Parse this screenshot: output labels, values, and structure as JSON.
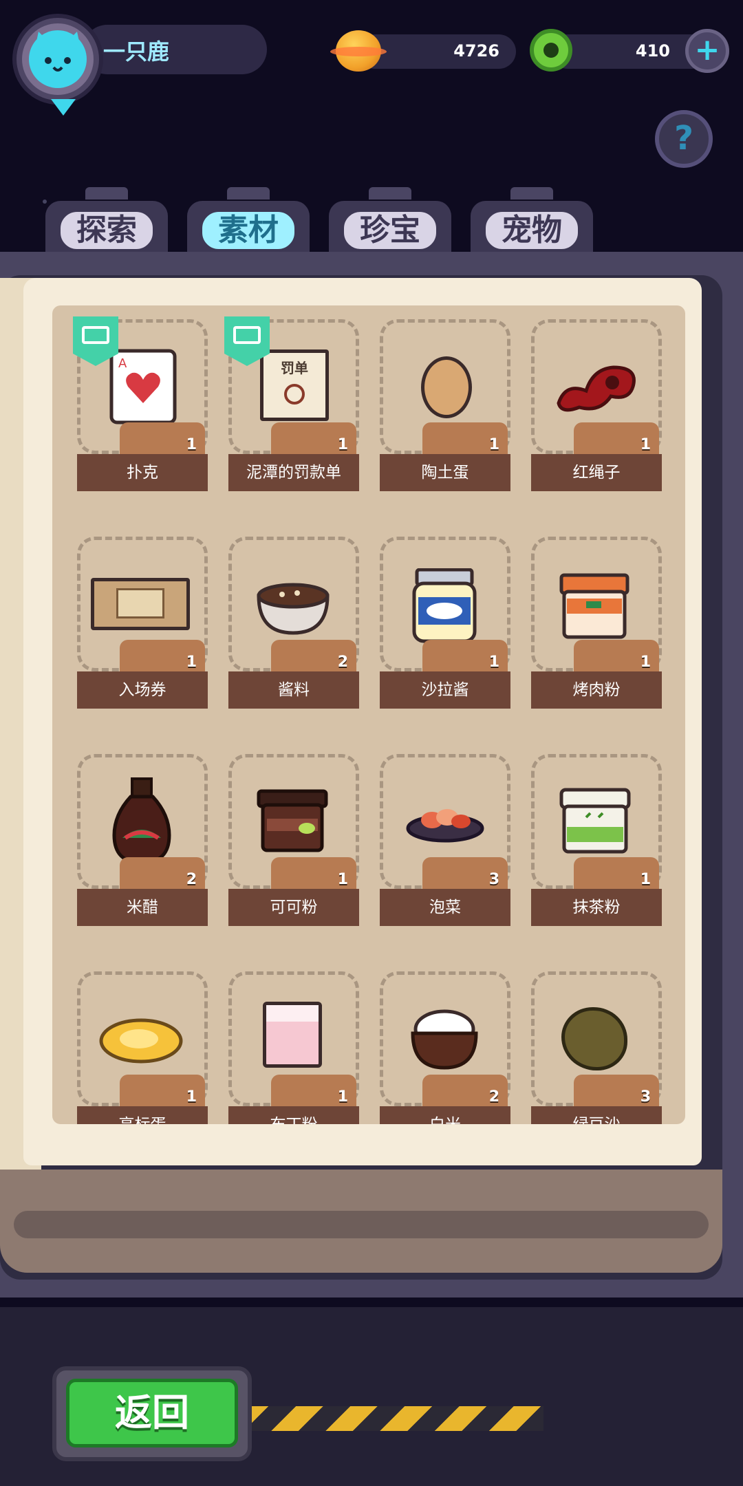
{
  "player": {
    "name": "一只鹿"
  },
  "resources": {
    "coins": "4726",
    "gems": "410"
  },
  "tabs": [
    {
      "label": "探索"
    },
    {
      "label": "素材",
      "active": true
    },
    {
      "label": "珍宝"
    },
    {
      "label": "宠物"
    }
  ],
  "items": [
    {
      "name": "扑克",
      "count": "1",
      "icon": "playing-card-icon",
      "bookmark": true
    },
    {
      "name": "泥潭的罚款单",
      "count": "1",
      "icon": "fine-ticket-icon",
      "bookmark": true,
      "icon_text": "罚单"
    },
    {
      "name": "陶土蛋",
      "count": "1",
      "icon": "clay-egg-icon"
    },
    {
      "name": "红绳子",
      "count": "1",
      "icon": "red-rope-icon"
    },
    {
      "name": "入场券",
      "count": "1",
      "icon": "admission-ticket-icon"
    },
    {
      "name": "酱料",
      "count": "2",
      "icon": "sauce-bowl-icon"
    },
    {
      "name": "沙拉酱",
      "count": "1",
      "icon": "mayonnaise-jar-icon"
    },
    {
      "name": "烤肉粉",
      "count": "1",
      "icon": "bbq-powder-icon"
    },
    {
      "name": "米醋",
      "count": "2",
      "icon": "rice-vinegar-bottle-icon"
    },
    {
      "name": "可可粉",
      "count": "1",
      "icon": "cocoa-powder-icon"
    },
    {
      "name": "泡菜",
      "count": "3",
      "icon": "kimchi-icon"
    },
    {
      "name": "抹茶粉",
      "count": "1",
      "icon": "matcha-powder-icon"
    },
    {
      "name": "高标蛋",
      "count": "1",
      "icon": "fried-egg-icon"
    },
    {
      "name": "布丁粉",
      "count": "1",
      "icon": "pudding-powder-icon"
    },
    {
      "name": "白米",
      "count": "2",
      "icon": "rice-bowl-icon"
    },
    {
      "name": "绿豆沙",
      "count": "3",
      "icon": "mung-bean-paste-icon"
    }
  ],
  "buttons": {
    "back": "返回",
    "help": "?",
    "add": "+"
  }
}
